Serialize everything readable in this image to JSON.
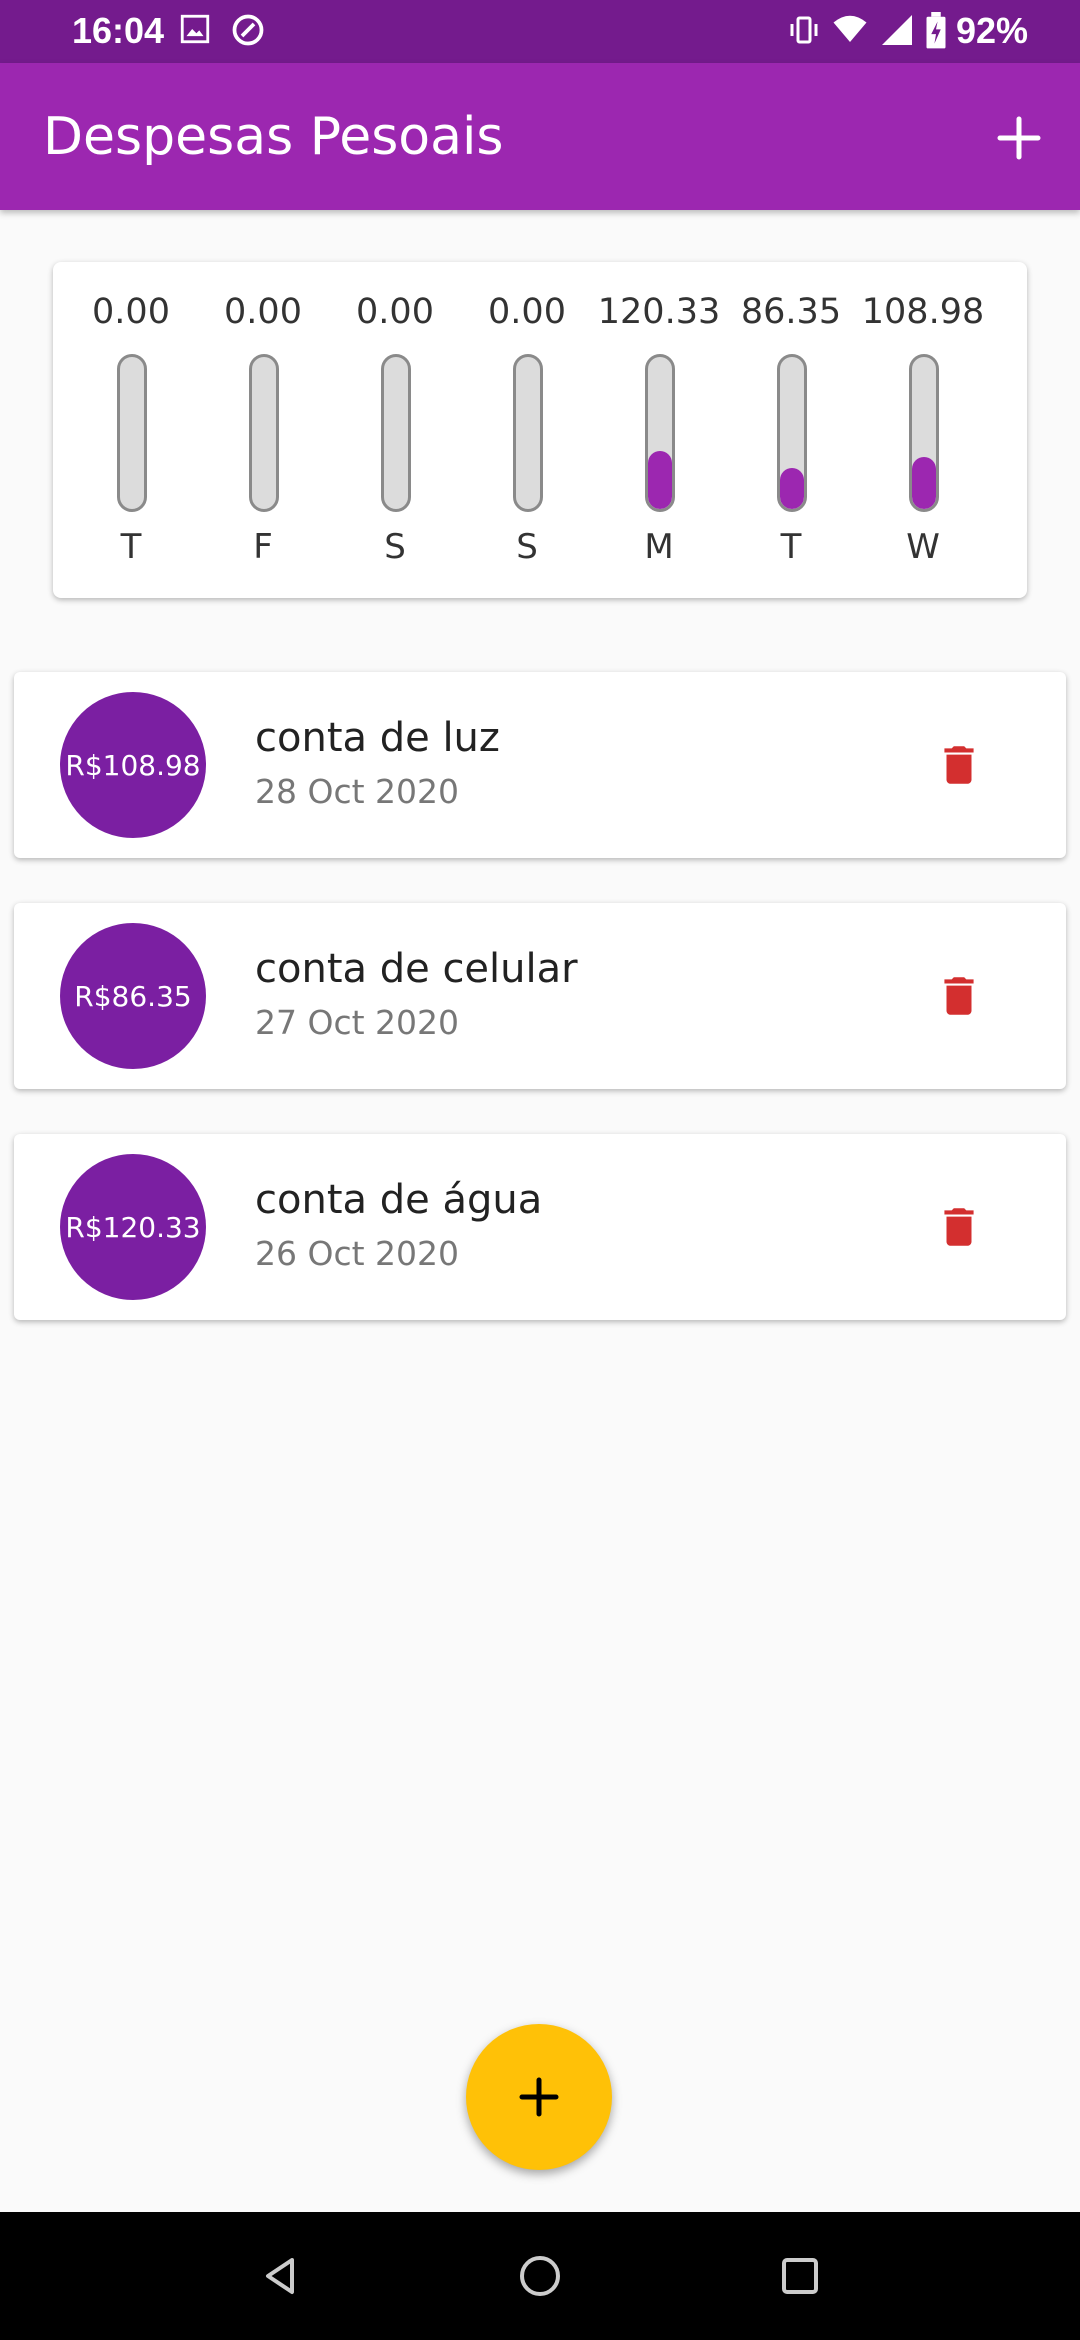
{
  "status_bar": {
    "time": "16:04",
    "battery": "92%",
    "icons": [
      "image-icon",
      "at-icon",
      "vibrate-icon",
      "wifi-icon",
      "signal-icon",
      "battery-icon"
    ]
  },
  "app_bar": {
    "title": "Despesas Pesoais",
    "add_icon": "plus-icon"
  },
  "chart_data": {
    "type": "bar",
    "categories": [
      "T",
      "F",
      "S",
      "S",
      "M",
      "T",
      "W"
    ],
    "values": [
      0.0,
      0.0,
      0.0,
      0.0,
      120.33,
      86.35,
      108.98
    ],
    "value_labels": [
      "0.00",
      "0.00",
      "0.00",
      "0.00",
      "120.33",
      "86.35",
      "108.98"
    ],
    "fill_fraction": [
      0,
      0,
      0,
      0,
      0.38,
      0.27,
      0.34
    ],
    "bar_color": "#9c27b0",
    "track_color": "#dcdcdc"
  },
  "transactions": [
    {
      "amount": "R$108.98",
      "title": "conta de luz",
      "date": "28 Oct 2020"
    },
    {
      "amount": "R$86.35",
      "title": "conta de celular",
      "date": "27 Oct 2020"
    },
    {
      "amount": "R$120.33",
      "title": "conta de água",
      "date": "26 Oct 2020"
    }
  ],
  "colors": {
    "primary": "#9c27b0",
    "avatar": "#7b1fa2",
    "fab": "#ffc107",
    "delete": "#d32f2f"
  }
}
